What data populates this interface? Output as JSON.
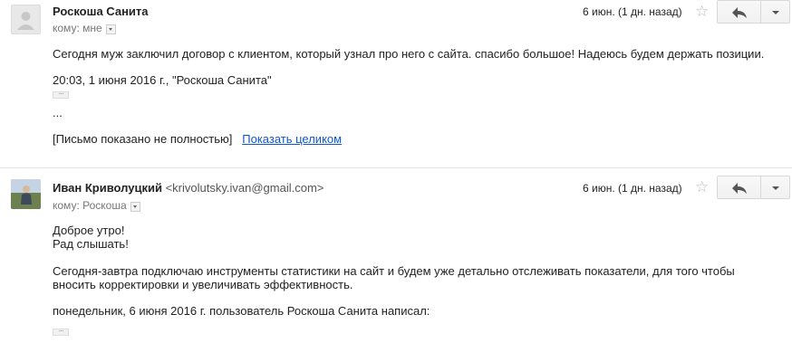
{
  "messages": [
    {
      "sender": "Роскоша Санита",
      "email": "",
      "to_label": "кому: мне",
      "date": "6 июн. (1 дн. назад)",
      "body": {
        "line1": "Сегодня муж заключил договор с клиентом, который узнал про него с сайта. спасибо большое! Надеюсь будем держать позиции.",
        "quote_header": "20:03, 1 июня 2016 г., \"Роскоша Санита\"",
        "ellipsis": "...",
        "truncated_note": "[Письмо показано не полностью]",
        "show_full_link": "Показать целиком"
      }
    },
    {
      "sender": "Иван Криволуцкий",
      "email": "<krivolutsky.ivan@gmail.com>",
      "to_label": "кому: Роскоша",
      "date": "6 июн. (1 дн. назад)",
      "body": {
        "line1": "Доброе утро!",
        "line2": "Рад слышать!",
        "para1": "Сегодня-завтра подключаю инструменты статистики на сайт и будем уже детально отслеживать показатели, для того чтобы",
        "para2": "вносить корректировки и увеличивать эффективность.",
        "quote_header": "понедельник, 6 июня 2016 г. пользователь Роскоша Санита написал:"
      }
    }
  ],
  "icons": {
    "star": "star-icon",
    "reply": "reply-icon",
    "more": "chevron-down-icon",
    "expand": "ellipsis-icon"
  },
  "colors": {
    "link": "#1155cc",
    "star": "#bbbbbb"
  }
}
